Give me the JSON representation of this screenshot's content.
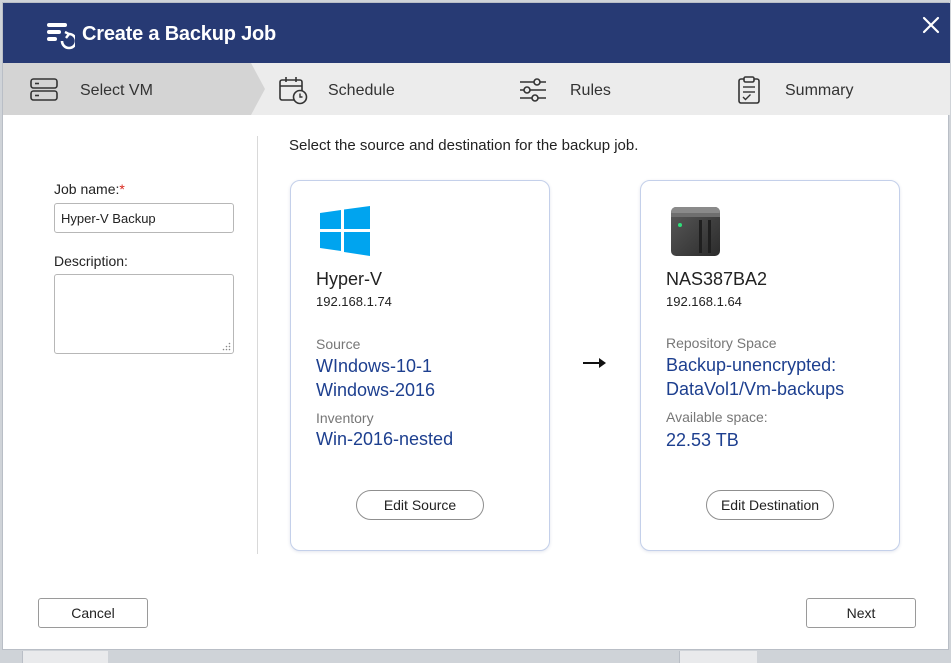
{
  "dialog": {
    "title": "Create a Backup Job",
    "close_icon": "close-icon"
  },
  "steps": [
    {
      "label": "Select VM",
      "icon": "server-icon",
      "active": true
    },
    {
      "label": "Schedule",
      "icon": "calendar-clock-icon",
      "active": false
    },
    {
      "label": "Rules",
      "icon": "sliders-icon",
      "active": false
    },
    {
      "label": "Summary",
      "icon": "clipboard-icon",
      "active": false
    }
  ],
  "form": {
    "job_name_label": "Job name:",
    "required_mark": "*",
    "job_name_value": "Hyper-V Backup",
    "description_label": "Description:",
    "description_value": ""
  },
  "instruction": "Select the source and destination for the backup job.",
  "source_card": {
    "icon": "windows-logo-icon",
    "name": "Hyper-V",
    "ip": "192.168.1.74",
    "source_label": "Source",
    "source_items": [
      "WIndows-10-1",
      "Windows-2016"
    ],
    "inventory_label": "Inventory",
    "inventory_value": "Win-2016-nested",
    "edit_label": "Edit Source"
  },
  "destination_card": {
    "icon": "nas-device-icon",
    "name": "NAS387BA2",
    "ip": "192.168.1.64",
    "repo_label": "Repository Space",
    "repo_lines": [
      "Backup-unencrypted:",
      "DataVol1/Vm-backups"
    ],
    "available_label": "Available space:",
    "available_value": "22.53 TB",
    "edit_label": "Edit Destination"
  },
  "footer": {
    "cancel_label": "Cancel",
    "next_label": "Next"
  },
  "colors": {
    "titlebar": "#273a74",
    "accent_text": "#1d3f8f",
    "windows_blue": "#00a4ef",
    "required": "#d9261c"
  }
}
